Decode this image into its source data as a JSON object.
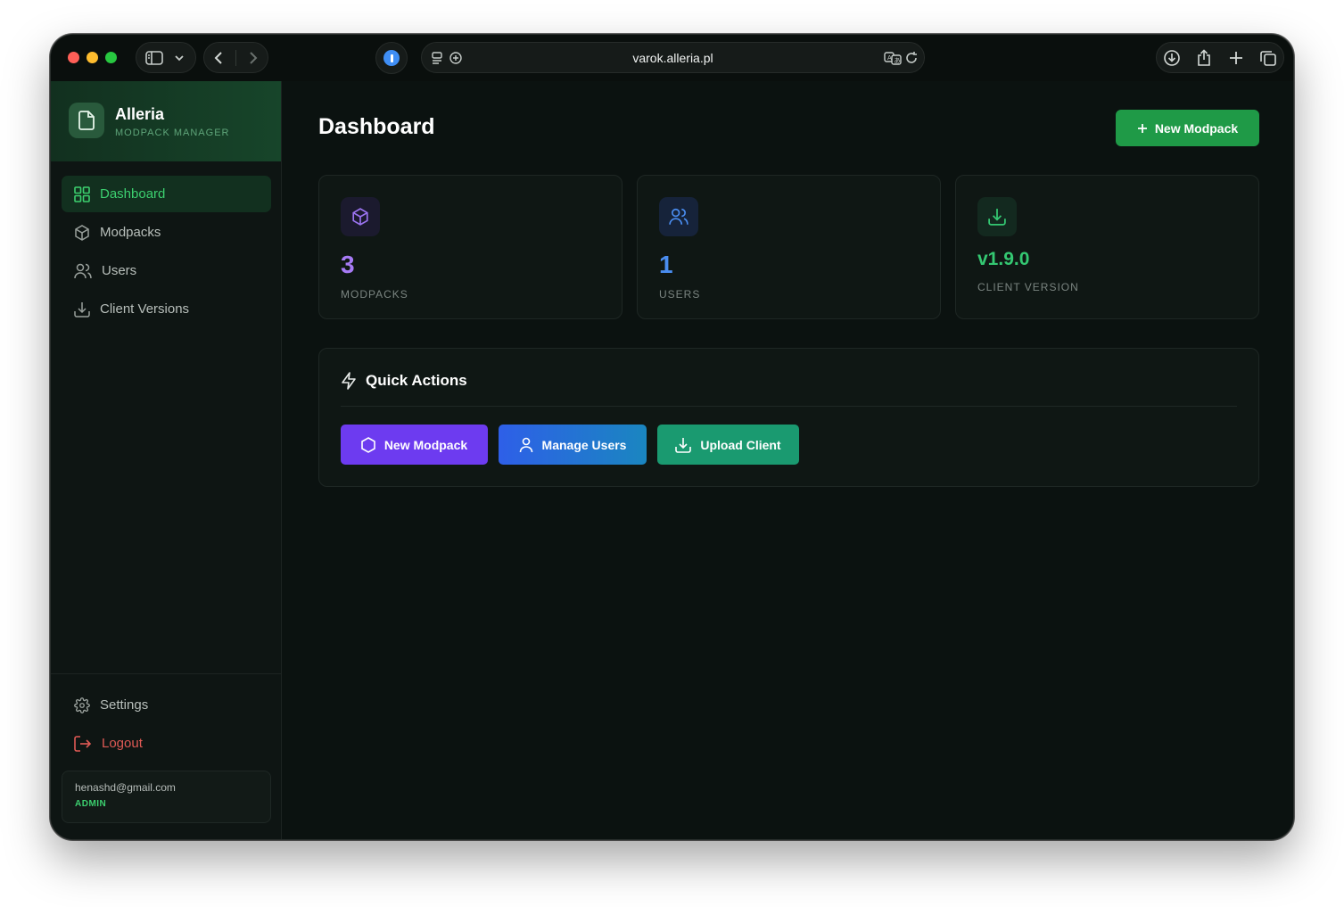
{
  "browser": {
    "url": "varok.alleria.pl"
  },
  "brand": {
    "title": "Alleria",
    "subtitle": "MODPACK MANAGER",
    "logo_icon": "file-icon"
  },
  "sidebar": {
    "items": [
      {
        "label": "Dashboard",
        "icon": "grid-icon",
        "active": true
      },
      {
        "label": "Modpacks",
        "icon": "cube-icon",
        "active": false
      },
      {
        "label": "Users",
        "icon": "users-icon",
        "active": false
      },
      {
        "label": "Client Versions",
        "icon": "download-icon",
        "active": false
      }
    ],
    "bottom": {
      "settings_label": "Settings",
      "logout_label": "Logout"
    },
    "user": {
      "email": "henashd@gmail.com",
      "role": "ADMIN"
    }
  },
  "main": {
    "title": "Dashboard",
    "new_modpack_label": "New Modpack",
    "stats": [
      {
        "value": "3",
        "label": "MODPACKS",
        "icon": "cube-icon",
        "color": "#a77bf5"
      },
      {
        "value": "1",
        "label": "USERS",
        "icon": "users-icon",
        "color": "#4a8df0"
      },
      {
        "value": "v1.9.0",
        "label": "CLIENT VERSION",
        "icon": "download-icon",
        "color": "#34c872"
      }
    ],
    "quick_actions": {
      "title": "Quick Actions",
      "buttons": [
        {
          "label": "New Modpack",
          "icon": "hexagon-icon"
        },
        {
          "label": "Manage Users",
          "icon": "user-icon"
        },
        {
          "label": "Upload Client",
          "icon": "download-icon"
        }
      ]
    }
  },
  "colors": {
    "accent": "#1f9a47",
    "active_nav": "#3ccf6f",
    "logout": "#e05a55",
    "purple": "#6d3bf0",
    "blue": "#2e66e8",
    "teal": "#1a9a70"
  }
}
